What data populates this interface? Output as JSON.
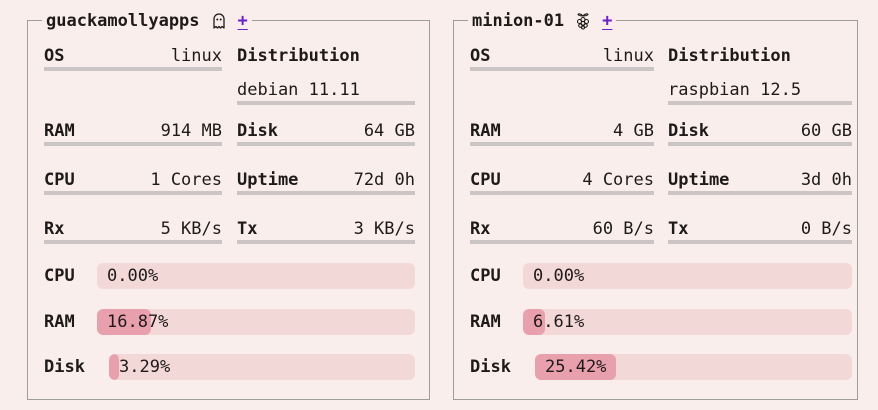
{
  "machines": [
    {
      "name": "guackamollyapps",
      "icon": "ghost-icon",
      "add_label": "+",
      "os_label": "OS",
      "os_value": "linux",
      "distribution_label": "Distribution",
      "distribution_value": "debian 11.11",
      "ram_label": "RAM",
      "ram_value": "914 MB",
      "disk_label": "Disk",
      "disk_value": "64 GB",
      "cpu_label": "CPU",
      "cpu_value": "1 Cores",
      "uptime_label": "Uptime",
      "uptime_value": "72d 0h",
      "rx_label": "Rx",
      "rx_value": "5 KB/s",
      "tx_label": "Tx",
      "tx_value": "3 KB/s",
      "usage": {
        "cpu_label": "CPU",
        "cpu_value": "0.00%",
        "cpu_fraction": 0.0,
        "ram_label": "RAM",
        "ram_value": "16.87%",
        "ram_fraction": 0.1687,
        "disk_label": "Disk",
        "disk_value": "3.29%",
        "disk_fraction": 0.0329
      }
    },
    {
      "name": "minion-01",
      "icon": "raspberry-icon",
      "add_label": "+",
      "os_label": "OS",
      "os_value": "linux",
      "distribution_label": "Distribution",
      "distribution_value": "raspbian 12.5",
      "ram_label": "RAM",
      "ram_value": "4 GB",
      "disk_label": "Disk",
      "disk_value": "60 GB",
      "cpu_label": "CPU",
      "cpu_value": "4 Cores",
      "uptime_label": "Uptime",
      "uptime_value": "3d 0h",
      "rx_label": "Rx",
      "rx_value": "60 B/s",
      "tx_label": "Tx",
      "tx_value": "0 B/s",
      "usage": {
        "cpu_label": "CPU",
        "cpu_value": "0.00%",
        "cpu_fraction": 0.0,
        "ram_label": "RAM",
        "ram_value": "6.61%",
        "ram_fraction": 0.0661,
        "disk_label": "Disk",
        "disk_value": "25.42%",
        "disk_fraction": 0.2542
      }
    }
  ],
  "colors": {
    "background": "#f9eeec",
    "border": "#9f9d9c",
    "divider": "#cbc6c5",
    "track": "#f2d8d6",
    "fill": "#e9a0ad",
    "accent": "#6a1fd0"
  }
}
